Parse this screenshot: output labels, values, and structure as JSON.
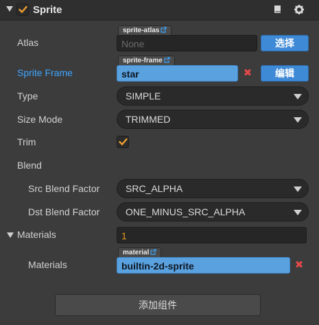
{
  "component": {
    "title": "Sprite",
    "enabled": true,
    "icons": [
      "book-icon",
      "gear-icon"
    ]
  },
  "properties": {
    "atlas": {
      "label": "Atlas",
      "tag": "sprite-atlas",
      "placeholder": "None",
      "button": "选择"
    },
    "sprite_frame": {
      "label": "Sprite Frame",
      "tag": "sprite-frame",
      "value": "star",
      "button": "编辑"
    },
    "type": {
      "label": "Type",
      "value": "SIMPLE"
    },
    "size_mode": {
      "label": "Size Mode",
      "value": "TRIMMED"
    },
    "trim": {
      "label": "Trim",
      "checked": true
    },
    "blend": {
      "label": "Blend"
    },
    "src_blend": {
      "label": "Src Blend Factor",
      "value": "SRC_ALPHA"
    },
    "dst_blend": {
      "label": "Dst Blend Factor",
      "value": "ONE_MINUS_SRC_ALPHA"
    },
    "materials": {
      "label": "Materials",
      "count": "1"
    },
    "material_item": {
      "label": "Materials",
      "tag": "material",
      "value": "builtin-2d-sprite"
    }
  },
  "footer": {
    "add_component": "添加组件"
  },
  "colors": {
    "accent": "#3f8ad6",
    "asset": "#5aa1df",
    "active_label": "#3ea6ff",
    "check": "#e79a22"
  }
}
